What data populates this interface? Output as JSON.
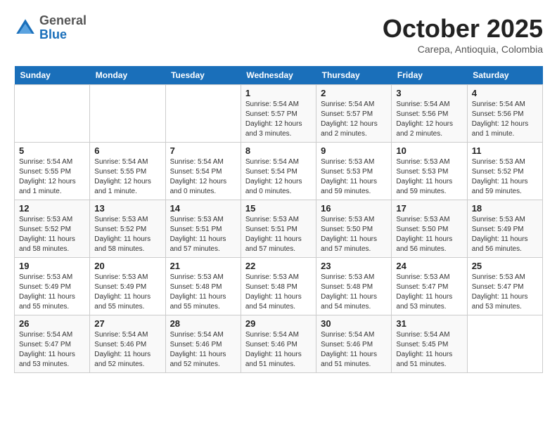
{
  "header": {
    "logo_general": "General",
    "logo_blue": "Blue",
    "title": "October 2025",
    "subtitle": "Carepa, Antioquia, Colombia"
  },
  "weekdays": [
    "Sunday",
    "Monday",
    "Tuesday",
    "Wednesday",
    "Thursday",
    "Friday",
    "Saturday"
  ],
  "weeks": [
    [
      {
        "day": "",
        "sunrise": "",
        "sunset": "",
        "daylight": ""
      },
      {
        "day": "",
        "sunrise": "",
        "sunset": "",
        "daylight": ""
      },
      {
        "day": "",
        "sunrise": "",
        "sunset": "",
        "daylight": ""
      },
      {
        "day": "1",
        "sunrise": "Sunrise: 5:54 AM",
        "sunset": "Sunset: 5:57 PM",
        "daylight": "Daylight: 12 hours and 3 minutes."
      },
      {
        "day": "2",
        "sunrise": "Sunrise: 5:54 AM",
        "sunset": "Sunset: 5:57 PM",
        "daylight": "Daylight: 12 hours and 2 minutes."
      },
      {
        "day": "3",
        "sunrise": "Sunrise: 5:54 AM",
        "sunset": "Sunset: 5:56 PM",
        "daylight": "Daylight: 12 hours and 2 minutes."
      },
      {
        "day": "4",
        "sunrise": "Sunrise: 5:54 AM",
        "sunset": "Sunset: 5:56 PM",
        "daylight": "Daylight: 12 hours and 1 minute."
      }
    ],
    [
      {
        "day": "5",
        "sunrise": "Sunrise: 5:54 AM",
        "sunset": "Sunset: 5:55 PM",
        "daylight": "Daylight: 12 hours and 1 minute."
      },
      {
        "day": "6",
        "sunrise": "Sunrise: 5:54 AM",
        "sunset": "Sunset: 5:55 PM",
        "daylight": "Daylight: 12 hours and 1 minute."
      },
      {
        "day": "7",
        "sunrise": "Sunrise: 5:54 AM",
        "sunset": "Sunset: 5:54 PM",
        "daylight": "Daylight: 12 hours and 0 minutes."
      },
      {
        "day": "8",
        "sunrise": "Sunrise: 5:54 AM",
        "sunset": "Sunset: 5:54 PM",
        "daylight": "Daylight: 12 hours and 0 minutes."
      },
      {
        "day": "9",
        "sunrise": "Sunrise: 5:53 AM",
        "sunset": "Sunset: 5:53 PM",
        "daylight": "Daylight: 11 hours and 59 minutes."
      },
      {
        "day": "10",
        "sunrise": "Sunrise: 5:53 AM",
        "sunset": "Sunset: 5:53 PM",
        "daylight": "Daylight: 11 hours and 59 minutes."
      },
      {
        "day": "11",
        "sunrise": "Sunrise: 5:53 AM",
        "sunset": "Sunset: 5:52 PM",
        "daylight": "Daylight: 11 hours and 59 minutes."
      }
    ],
    [
      {
        "day": "12",
        "sunrise": "Sunrise: 5:53 AM",
        "sunset": "Sunset: 5:52 PM",
        "daylight": "Daylight: 11 hours and 58 minutes."
      },
      {
        "day": "13",
        "sunrise": "Sunrise: 5:53 AM",
        "sunset": "Sunset: 5:52 PM",
        "daylight": "Daylight: 11 hours and 58 minutes."
      },
      {
        "day": "14",
        "sunrise": "Sunrise: 5:53 AM",
        "sunset": "Sunset: 5:51 PM",
        "daylight": "Daylight: 11 hours and 57 minutes."
      },
      {
        "day": "15",
        "sunrise": "Sunrise: 5:53 AM",
        "sunset": "Sunset: 5:51 PM",
        "daylight": "Daylight: 11 hours and 57 minutes."
      },
      {
        "day": "16",
        "sunrise": "Sunrise: 5:53 AM",
        "sunset": "Sunset: 5:50 PM",
        "daylight": "Daylight: 11 hours and 57 minutes."
      },
      {
        "day": "17",
        "sunrise": "Sunrise: 5:53 AM",
        "sunset": "Sunset: 5:50 PM",
        "daylight": "Daylight: 11 hours and 56 minutes."
      },
      {
        "day": "18",
        "sunrise": "Sunrise: 5:53 AM",
        "sunset": "Sunset: 5:49 PM",
        "daylight": "Daylight: 11 hours and 56 minutes."
      }
    ],
    [
      {
        "day": "19",
        "sunrise": "Sunrise: 5:53 AM",
        "sunset": "Sunset: 5:49 PM",
        "daylight": "Daylight: 11 hours and 55 minutes."
      },
      {
        "day": "20",
        "sunrise": "Sunrise: 5:53 AM",
        "sunset": "Sunset: 5:49 PM",
        "daylight": "Daylight: 11 hours and 55 minutes."
      },
      {
        "day": "21",
        "sunrise": "Sunrise: 5:53 AM",
        "sunset": "Sunset: 5:48 PM",
        "daylight": "Daylight: 11 hours and 55 minutes."
      },
      {
        "day": "22",
        "sunrise": "Sunrise: 5:53 AM",
        "sunset": "Sunset: 5:48 PM",
        "daylight": "Daylight: 11 hours and 54 minutes."
      },
      {
        "day": "23",
        "sunrise": "Sunrise: 5:53 AM",
        "sunset": "Sunset: 5:48 PM",
        "daylight": "Daylight: 11 hours and 54 minutes."
      },
      {
        "day": "24",
        "sunrise": "Sunrise: 5:53 AM",
        "sunset": "Sunset: 5:47 PM",
        "daylight": "Daylight: 11 hours and 53 minutes."
      },
      {
        "day": "25",
        "sunrise": "Sunrise: 5:53 AM",
        "sunset": "Sunset: 5:47 PM",
        "daylight": "Daylight: 11 hours and 53 minutes."
      }
    ],
    [
      {
        "day": "26",
        "sunrise": "Sunrise: 5:54 AM",
        "sunset": "Sunset: 5:47 PM",
        "daylight": "Daylight: 11 hours and 53 minutes."
      },
      {
        "day": "27",
        "sunrise": "Sunrise: 5:54 AM",
        "sunset": "Sunset: 5:46 PM",
        "daylight": "Daylight: 11 hours and 52 minutes."
      },
      {
        "day": "28",
        "sunrise": "Sunrise: 5:54 AM",
        "sunset": "Sunset: 5:46 PM",
        "daylight": "Daylight: 11 hours and 52 minutes."
      },
      {
        "day": "29",
        "sunrise": "Sunrise: 5:54 AM",
        "sunset": "Sunset: 5:46 PM",
        "daylight": "Daylight: 11 hours and 51 minutes."
      },
      {
        "day": "30",
        "sunrise": "Sunrise: 5:54 AM",
        "sunset": "Sunset: 5:46 PM",
        "daylight": "Daylight: 11 hours and 51 minutes."
      },
      {
        "day": "31",
        "sunrise": "Sunrise: 5:54 AM",
        "sunset": "Sunset: 5:45 PM",
        "daylight": "Daylight: 11 hours and 51 minutes."
      },
      {
        "day": "",
        "sunrise": "",
        "sunset": "",
        "daylight": ""
      }
    ]
  ]
}
